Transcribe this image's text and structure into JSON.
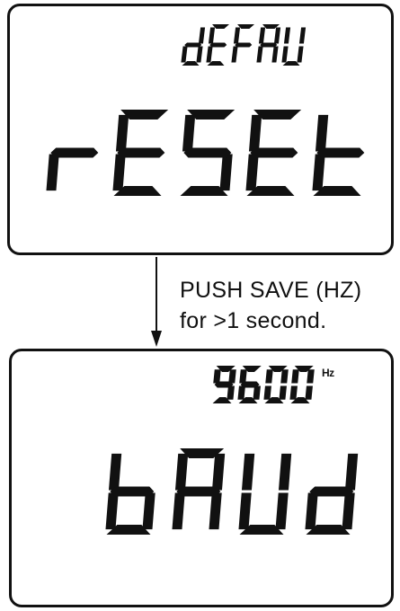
{
  "panel_top": {
    "top_readout": "dEFAU",
    "main_readout": "rESEt"
  },
  "transition": {
    "line1": "PUSH SAVE (HZ)",
    "line2": "for >1 second."
  },
  "panel_bottom": {
    "top_readout": "9600",
    "unit": "Hz",
    "main_readout": "bAUd"
  }
}
